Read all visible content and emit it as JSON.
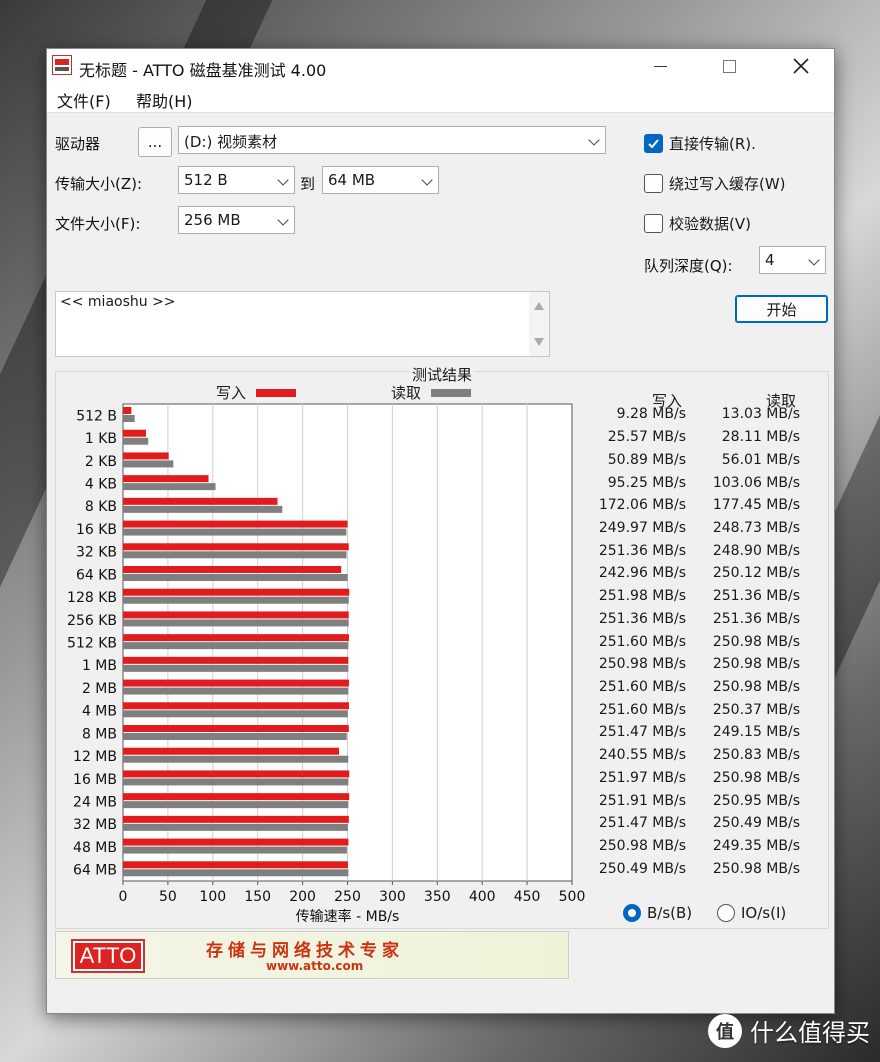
{
  "window": {
    "title": "无标题 - ATTO 磁盘基准测试 4.00"
  },
  "menu": {
    "file": "文件(F)",
    "help": "帮助(H)"
  },
  "drive": {
    "label": "驱动器",
    "browse": "...",
    "value": "(D:) 视频素材"
  },
  "transfer": {
    "label": "传输大小(Z):",
    "from": "512 B",
    "to_label": "到",
    "to": "64 MB"
  },
  "filesize": {
    "label": "文件大小(F):",
    "value": "256 MB"
  },
  "options": {
    "direct_io": {
      "label": "直接传输(R).",
      "checked": true
    },
    "bypass_cache": {
      "label": "绕过写入缓存(W)",
      "checked": false
    },
    "verify": {
      "label": "校验数据(V)",
      "checked": false
    },
    "queue_label": "队列深度(Q):",
    "queue_value": "4",
    "start": "开始"
  },
  "description": "<< miaoshu >>",
  "results": {
    "title": "测试结果",
    "legend_write": "写入",
    "legend_read": "读取",
    "col_write": "写入",
    "col_read": "读取",
    "rows": [
      {
        "size": "512 B",
        "write": "9.28 MB/s",
        "read": "13.03 MB/s"
      },
      {
        "size": "1 KB",
        "write": "25.57 MB/s",
        "read": "28.11 MB/s"
      },
      {
        "size": "2 KB",
        "write": "50.89 MB/s",
        "read": "56.01 MB/s"
      },
      {
        "size": "4 KB",
        "write": "95.25 MB/s",
        "read": "103.06 MB/s"
      },
      {
        "size": "8 KB",
        "write": "172.06 MB/s",
        "read": "177.45 MB/s"
      },
      {
        "size": "16 KB",
        "write": "249.97 MB/s",
        "read": "248.73 MB/s"
      },
      {
        "size": "32 KB",
        "write": "251.36 MB/s",
        "read": "248.90 MB/s"
      },
      {
        "size": "64 KB",
        "write": "242.96 MB/s",
        "read": "250.12 MB/s"
      },
      {
        "size": "128 KB",
        "write": "251.98 MB/s",
        "read": "251.36 MB/s"
      },
      {
        "size": "256 KB",
        "write": "251.36 MB/s",
        "read": "251.36 MB/s"
      },
      {
        "size": "512 KB",
        "write": "251.60 MB/s",
        "read": "250.98 MB/s"
      },
      {
        "size": "1 MB",
        "write": "250.98 MB/s",
        "read": "250.98 MB/s"
      },
      {
        "size": "2 MB",
        "write": "251.60 MB/s",
        "read": "250.98 MB/s"
      },
      {
        "size": "4 MB",
        "write": "251.60 MB/s",
        "read": "250.37 MB/s"
      },
      {
        "size": "8 MB",
        "write": "251.47 MB/s",
        "read": "249.15 MB/s"
      },
      {
        "size": "12 MB",
        "write": "240.55 MB/s",
        "read": "250.83 MB/s"
      },
      {
        "size": "16 MB",
        "write": "251.97 MB/s",
        "read": "250.98 MB/s"
      },
      {
        "size": "24 MB",
        "write": "251.91 MB/s",
        "read": "250.95 MB/s"
      },
      {
        "size": "32 MB",
        "write": "251.47 MB/s",
        "read": "250.49 MB/s"
      },
      {
        "size": "48 MB",
        "write": "250.98 MB/s",
        "read": "249.35 MB/s"
      },
      {
        "size": "64 MB",
        "write": "250.49 MB/s",
        "read": "250.98 MB/s"
      }
    ],
    "unit_bytes": "B/s(B)",
    "unit_io": "IO/s(I)"
  },
  "chart_data": {
    "type": "bar",
    "orientation": "horizontal",
    "categories": [
      "512 B",
      "1 KB",
      "2 KB",
      "4 KB",
      "8 KB",
      "16 KB",
      "32 KB",
      "64 KB",
      "128 KB",
      "256 KB",
      "512 KB",
      "1 MB",
      "2 MB",
      "4 MB",
      "8 MB",
      "12 MB",
      "16 MB",
      "24 MB",
      "32 MB",
      "48 MB",
      "64 MB"
    ],
    "series": [
      {
        "name": "写入",
        "color": "#e21c1c",
        "values": [
          9.28,
          25.57,
          50.89,
          95.25,
          172.06,
          249.97,
          251.36,
          242.96,
          251.98,
          251.36,
          251.6,
          250.98,
          251.6,
          251.6,
          251.47,
          240.55,
          251.97,
          251.91,
          251.47,
          250.98,
          250.49
        ]
      },
      {
        "name": "读取",
        "color": "#7f7f7f",
        "values": [
          13.03,
          28.11,
          56.01,
          103.06,
          177.45,
          248.73,
          248.9,
          250.12,
          251.36,
          251.36,
          250.98,
          250.98,
          250.98,
          250.37,
          249.15,
          250.83,
          250.98,
          250.95,
          250.49,
          249.35,
          250.98
        ]
      }
    ],
    "xlabel": "传输速率 - MB/s",
    "xlim": [
      0,
      500
    ],
    "xticks": [
      0,
      50,
      100,
      150,
      200,
      250,
      300,
      350,
      400,
      450,
      500
    ],
    "grid": true
  },
  "banner": {
    "logo": "ATTO",
    "slogan": "存储与网络技术专家",
    "site": "www.atto.com"
  },
  "watermark": {
    "icon": "值",
    "text": "什么值得买"
  }
}
